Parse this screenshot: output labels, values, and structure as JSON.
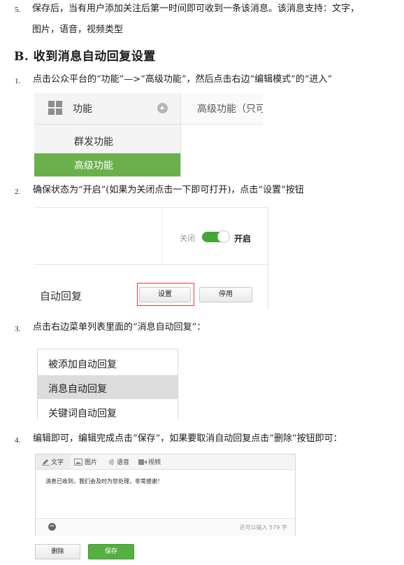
{
  "step5": {
    "num": "5.",
    "line1": "保存后，当有用户添加关注后第一时间即可收到一条该消息。该消息支持：文字，",
    "line2": "图片，语音，视频类型"
  },
  "section_b": {
    "heading": "B.  收到消息自动回复设置"
  },
  "steps": [
    {
      "num": "1.",
      "text": "点击公众平台的“功能”—>“高级功能”，然后点击右边“编辑模式”的“进入”"
    },
    {
      "num": "2.",
      "text": "确保状态为“开启”(如果为关闭点击一下即可打开)，点击“设置”按钮"
    },
    {
      "num": "3.",
      "text": "点击右边菜单列表里面的“消息自动回复”："
    },
    {
      "num": "4.",
      "text": "编辑即可，编辑完成点击“保存”，如果要取消自动回复点击“删除”按钮即可："
    }
  ],
  "shot1": {
    "menu_title": "功能",
    "items": [
      "群发功能",
      "高级功能"
    ],
    "right_label": "高级功能（只可"
  },
  "shot2": {
    "off_label": "关闭",
    "on_label": "开启",
    "auto_reply_label": "自动回复",
    "settings_button": "设置",
    "disable_button": "停用",
    "toggle_on": true
  },
  "shot3": {
    "items": [
      "被添加自动回复",
      "消息自动回复",
      "关键词自动回复"
    ],
    "selected_index": 1
  },
  "shot4": {
    "tabs": [
      "文字",
      "图片",
      "语音",
      "视频"
    ],
    "message_text": "消息已收到，我们会及时为您处理，非常感谢！",
    "remaining_text": "还可以输入 579 字",
    "delete_button": "删除",
    "save_button": "保存"
  },
  "colors": {
    "menu_selected": "#6ab04c",
    "toggle": "#42a833",
    "highlight_outline": "#e53a3a",
    "save_button": "#54b041"
  }
}
